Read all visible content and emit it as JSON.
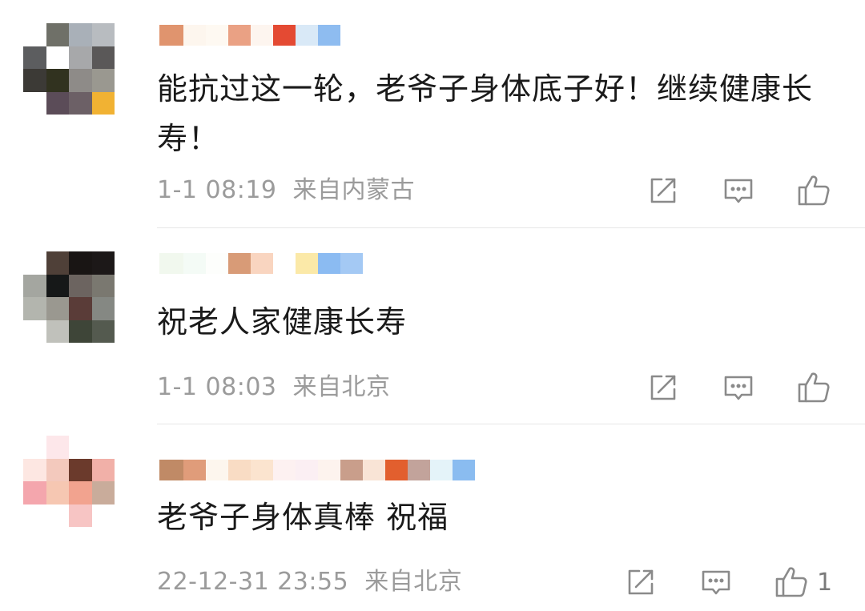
{
  "comments": [
    {
      "text": "能抗过这一轮，老爷子身体底子好！继续健康长寿！",
      "time": "1-1 08:19",
      "location": "来自内蒙古",
      "likes": ""
    },
    {
      "text": "祝老人家健康长寿",
      "time": "1-1 08:03",
      "location": "来自北京",
      "likes": ""
    },
    {
      "text": "老爷子身体真棒 祝福",
      "time": "22-12-31 23:55",
      "location": "来自北京",
      "likes": "1"
    }
  ],
  "icons": {
    "share": "share-icon",
    "comment": "comment-icon",
    "like": "thumbs-up-icon"
  },
  "colors": {
    "text": "#1a1a1a",
    "meta": "#9b9b9b",
    "icon": "#8a8a8a",
    "divider": "#e6e6e6"
  }
}
